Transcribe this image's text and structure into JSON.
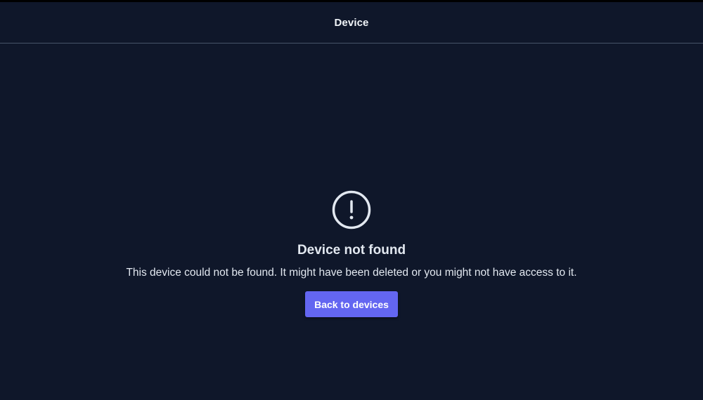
{
  "header": {
    "title": "Device"
  },
  "error": {
    "icon": "alert-circle-icon",
    "title": "Device not found",
    "message": "This device could not be found. It might have been deleted or you might not have access to it.",
    "button_label": "Back to devices"
  },
  "colors": {
    "background": "#0f172a",
    "accent": "#6366f1",
    "text": "#e2e8f0"
  }
}
